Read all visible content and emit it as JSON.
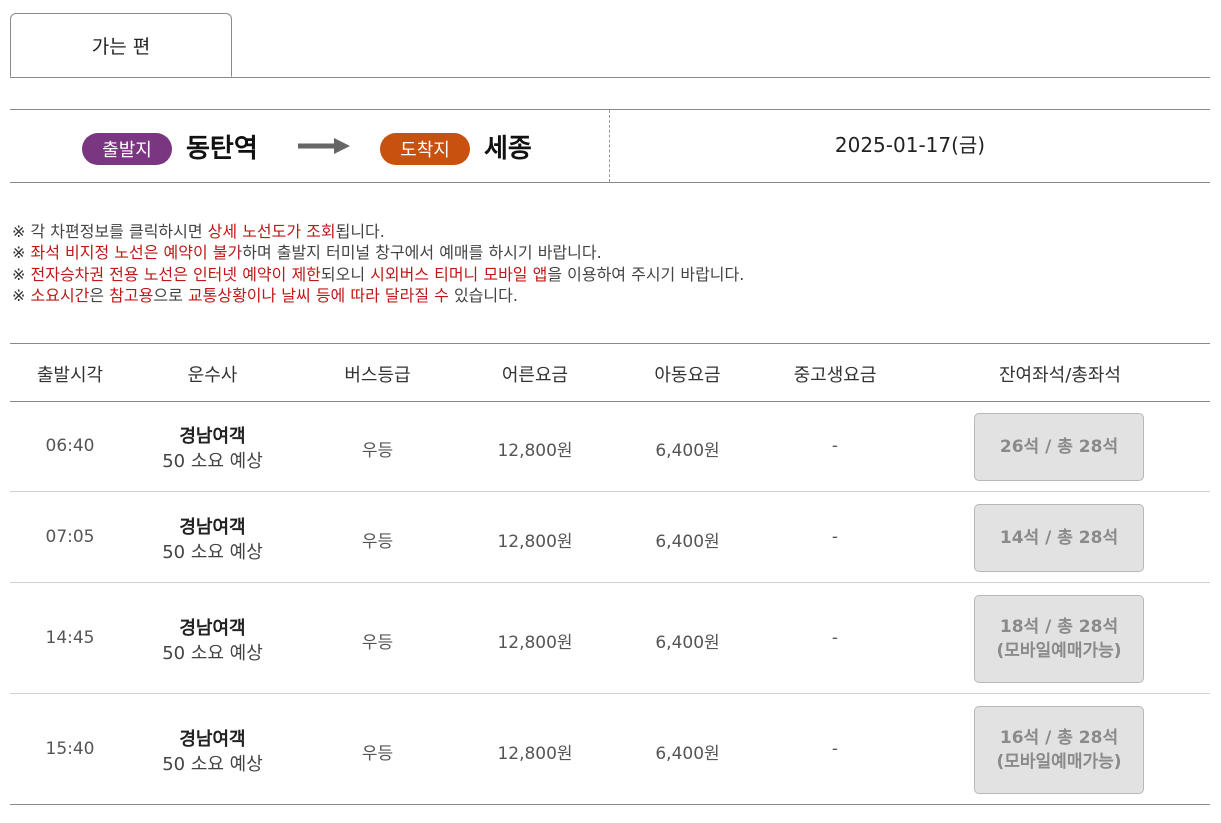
{
  "tab": {
    "label": "가는 편"
  },
  "route": {
    "departure_badge": "출발지",
    "departure": "동탄역",
    "arrival_badge": "도착지",
    "arrival": "세종",
    "date": "2025-01-17(금)",
    "colors": {
      "departure_badge": "#7b3681",
      "arrival_badge": "#c8510f"
    }
  },
  "notices": [
    {
      "mark": "※",
      "parts": [
        {
          "t": " 각 차편정보를 클릭하시면 "
        },
        {
          "t": "상세 노선도가 조회",
          "hl": true
        },
        {
          "t": "됩니다."
        }
      ]
    },
    {
      "mark": "※",
      "parts": [
        {
          "t": " "
        },
        {
          "t": "좌석 비지정 노선은 예약이 불가",
          "hl": true
        },
        {
          "t": "하며 출발지 터미널 창구에서 예매를 하시기 바랍니다."
        }
      ]
    },
    {
      "mark": "※",
      "parts": [
        {
          "t": " "
        },
        {
          "t": "전자승차권 전용 노선은 인터넷 예약이 제한",
          "hl": true
        },
        {
          "t": "되오니 "
        },
        {
          "t": "시외버스 티머니 모바일 앱",
          "hl": true
        },
        {
          "t": "을 이용하여 주시기 바랍니다."
        }
      ]
    },
    {
      "mark": "※",
      "parts": [
        {
          "t": " "
        },
        {
          "t": "소요시간",
          "hl": true
        },
        {
          "t": "은 "
        },
        {
          "t": "참고용",
          "hl": true
        },
        {
          "t": "으로 "
        },
        {
          "t": "교통상황이나 날씨 등에 따라 달라질 수",
          "hl": true
        },
        {
          "t": " 있습니다."
        }
      ]
    }
  ],
  "table": {
    "headers": [
      "출발시각",
      "운수사",
      "버스등급",
      "어른요금",
      "아동요금",
      "중고생요금",
      "잔여좌석/총좌석"
    ],
    "rows": [
      {
        "time": "06:40",
        "company": "경남여객",
        "eta": "50 소요 예상",
        "grade": "우등",
        "adult": "12,800원",
        "child": "6,400원",
        "student": "-",
        "seats": "26석 / 총 28석",
        "seat_note": ""
      },
      {
        "time": "07:05",
        "company": "경남여객",
        "eta": "50 소요 예상",
        "grade": "우등",
        "adult": "12,800원",
        "child": "6,400원",
        "student": "-",
        "seats": "14석 / 총 28석",
        "seat_note": ""
      },
      {
        "time": "14:45",
        "company": "경남여객",
        "eta": "50 소요 예상",
        "grade": "우등",
        "adult": "12,800원",
        "child": "6,400원",
        "student": "-",
        "seats": "18석 / 총 28석",
        "seat_note": "(모바일예매가능)"
      },
      {
        "time": "15:40",
        "company": "경남여객",
        "eta": "50 소요 예상",
        "grade": "우등",
        "adult": "12,800원",
        "child": "6,400원",
        "student": "-",
        "seats": "16석 / 총 28석",
        "seat_note": "(모바일예매가능)"
      }
    ]
  },
  "colors": {
    "highlight": "#c01818",
    "seat_button_bg": "#e2e2e2"
  }
}
